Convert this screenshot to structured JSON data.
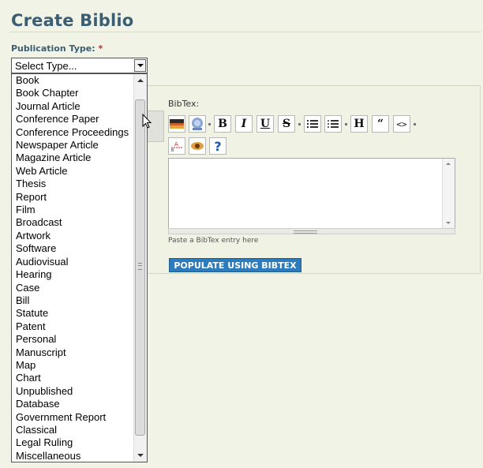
{
  "page": {
    "title": "Create Biblio"
  },
  "publication_type": {
    "label": "Publication Type:",
    "required_mark": "*",
    "selected": "Select Type...",
    "options": [
      "Book",
      "Book Chapter",
      "Journal Article",
      "Conference Paper",
      "Conference Proceedings",
      "Newspaper Article",
      "Magazine Article",
      "Web Article",
      "Thesis",
      "Report",
      "Film",
      "Broadcast",
      "Artwork",
      "Software",
      "Audiovisual",
      "Hearing",
      "Case",
      "Bill",
      "Statute",
      "Patent",
      "Personal",
      "Manuscript",
      "Map",
      "Chart",
      "Unpublished",
      "Database",
      "Government Report",
      "Classical",
      "Legal Ruling",
      "Miscellaneous"
    ]
  },
  "bibtex": {
    "label": "BibTex:",
    "hint": "Paste a BibTex entry here",
    "populate_button": "POPULATE USING BIBTEX",
    "toolbar": {
      "bold": "B",
      "italic": "I",
      "underline": "U",
      "strike": "S",
      "heading": "H",
      "quote": "“",
      "code": "<>",
      "help": "?"
    }
  }
}
